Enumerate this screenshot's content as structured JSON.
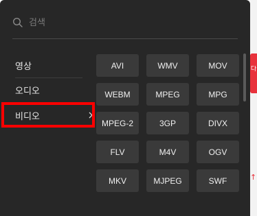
{
  "search": {
    "placeholder": "검색"
  },
  "categories": [
    {
      "label": "영상"
    },
    {
      "label": "오디오"
    },
    {
      "label": "비디오"
    }
  ],
  "formats": [
    "AVI",
    "WMV",
    "MOV",
    "WEBM",
    "MPEG",
    "MPG",
    "MPEG-2",
    "3GP",
    "DIVX",
    "FLV",
    "M4V",
    "OGV",
    "MKV",
    "MJPEG",
    "SWF"
  ],
  "colors": {
    "panel_bg": "#272727",
    "button_bg": "#3a3a3a",
    "highlight": "#ff0000",
    "brand_red": "#e8323c"
  },
  "background": {
    "tab_text": "다"
  }
}
